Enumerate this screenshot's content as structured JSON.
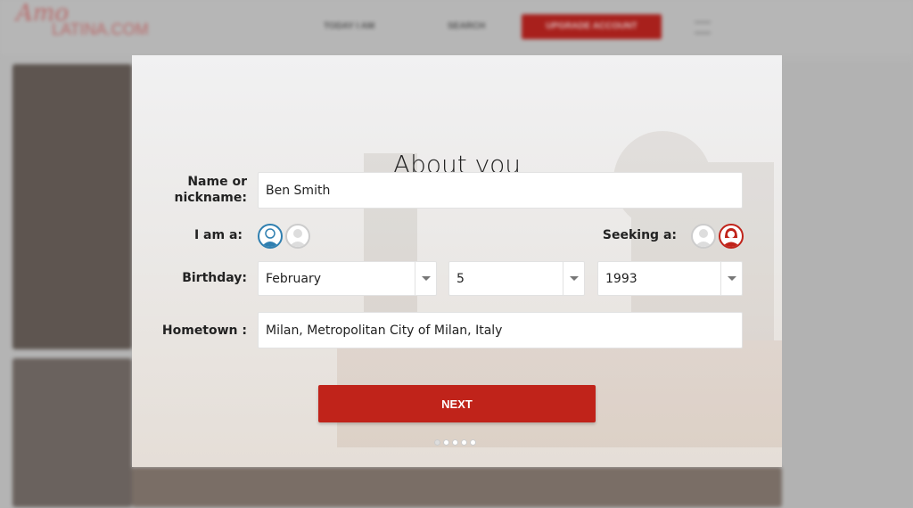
{
  "header": {
    "logo_top": "Amo",
    "logo_bottom": "LATINA.COM",
    "nav": [
      "TODAY I AM",
      "SEARCH"
    ],
    "upgrade": "UPGRADE ACCOUNT",
    "accent": "#a8201c"
  },
  "modal": {
    "title": "About you",
    "name_label": "Name or nickname:",
    "name_value": "Ben Smith",
    "iam_label": "I am a:",
    "seeking_label": "Seeking a:",
    "iam_selected": "male",
    "seeking_selected": "female",
    "birthday_label": "Birthday:",
    "birth_month": "February",
    "birth_day": "5",
    "birth_year": "1993",
    "hometown_label": "Hometown :",
    "hometown_value": "Milan, Metropolitan City of Milan, Italy",
    "next_label": "NEXT",
    "step": 1,
    "steps": 5,
    "colors": {
      "button": "#c0231a",
      "male": "#2f7fb0",
      "female": "#c0231a"
    }
  }
}
